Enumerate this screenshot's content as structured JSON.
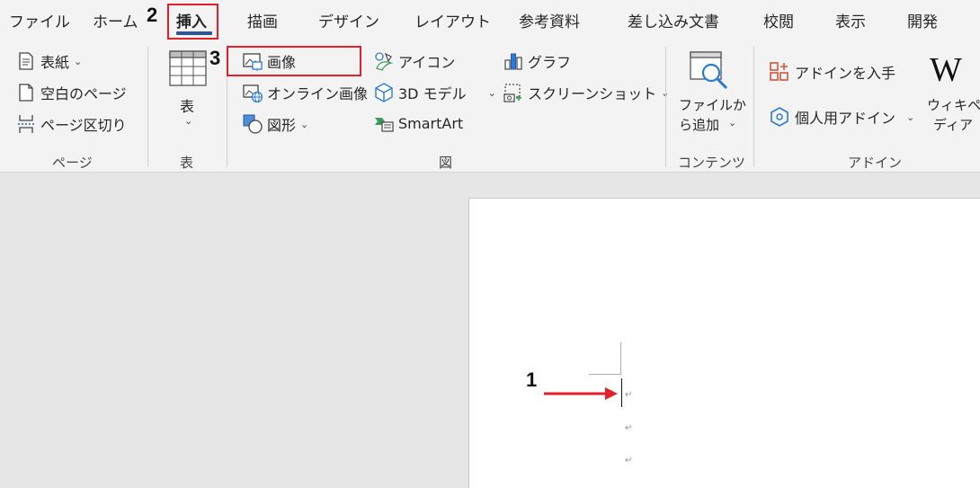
{
  "tabs": [
    "ファイル",
    "ホーム",
    "挿入",
    "描画",
    "デザイン",
    "レイアウト",
    "参考資料",
    "差し込み文書",
    "校閲",
    "表示",
    "開発"
  ],
  "active_tab": "挿入",
  "groups": {
    "page": {
      "label": "ページ",
      "cover": "表紙",
      "blank": "空白のページ",
      "break": "ページ区切り"
    },
    "table": {
      "label": "表",
      "button": "表"
    },
    "illustrations": {
      "label": "図",
      "picture": "画像",
      "online_picture": "オンライン画像",
      "shapes": "図形",
      "icons": "アイコン",
      "model3d": "3D モデル",
      "smartart": "SmartArt",
      "chart": "グラフ",
      "screenshot": "スクリーンショット"
    },
    "content": {
      "label": "コンテンツ",
      "add_from_file_1": "ファイルか",
      "add_from_file_2": "ら追加"
    },
    "addins": {
      "label": "アドイン",
      "get": "アドインを入手",
      "my": "個人用アドイン",
      "wiki_1": "ウィキペ",
      "wiki_2": "ディア",
      "wiki_logo": "W"
    }
  },
  "annotations": {
    "step1": "1",
    "step2": "2",
    "step3": "3",
    "color": "#e0202a"
  },
  "document": {
    "para_mark": "↵"
  }
}
